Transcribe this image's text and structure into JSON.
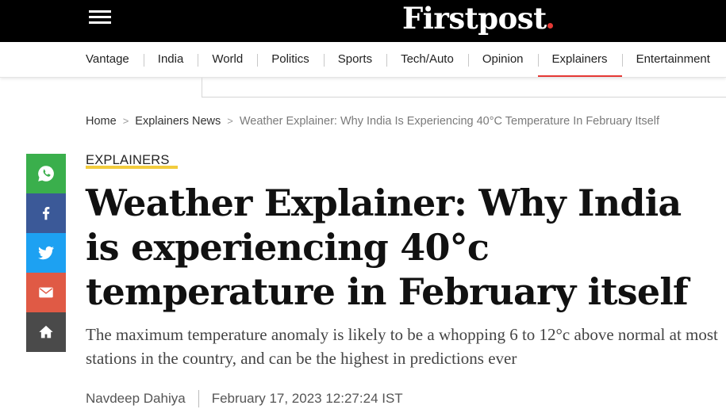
{
  "header": {
    "menu_icon": "hamburger-menu-icon",
    "logo_text": "Firstpost",
    "background": "#000000",
    "accent": "#e53935"
  },
  "nav": {
    "items": [
      {
        "label": "Vantage"
      },
      {
        "label": "India"
      },
      {
        "label": "World"
      },
      {
        "label": "Politics"
      },
      {
        "label": "Sports"
      },
      {
        "label": "Tech/Auto"
      },
      {
        "label": "Opinion"
      },
      {
        "label": "Explainers",
        "active": true
      },
      {
        "label": "Entertainment"
      }
    ]
  },
  "breadcrumb": {
    "home": "Home",
    "section": "Explainers News",
    "current": "Weather Explainer: Why India Is Experiencing 40°C Temperature In February Itself"
  },
  "share": {
    "icons": [
      "whatsapp-icon",
      "facebook-icon",
      "twitter-icon",
      "email-icon",
      "home-icon"
    ],
    "colors": {
      "whatsapp": "#3aaf4c",
      "facebook": "#3b5998",
      "twitter": "#1da1f2",
      "email": "#e05a45",
      "home": "#4a4a4a"
    }
  },
  "article": {
    "category": "EXPLAINERS",
    "category_underline_color": "#f2cc3d",
    "headline": "Weather Explainer: Why India is experiencing 40°c temperature in February itself",
    "summary": "The maximum temperature anomaly is likely to be a whopping 6 to 12°c above normal at most stations in the country, and can be the highest in predictions ever",
    "author": "Navdeep Dahiya",
    "date": "February 17, 2023 12:27:24 IST"
  }
}
